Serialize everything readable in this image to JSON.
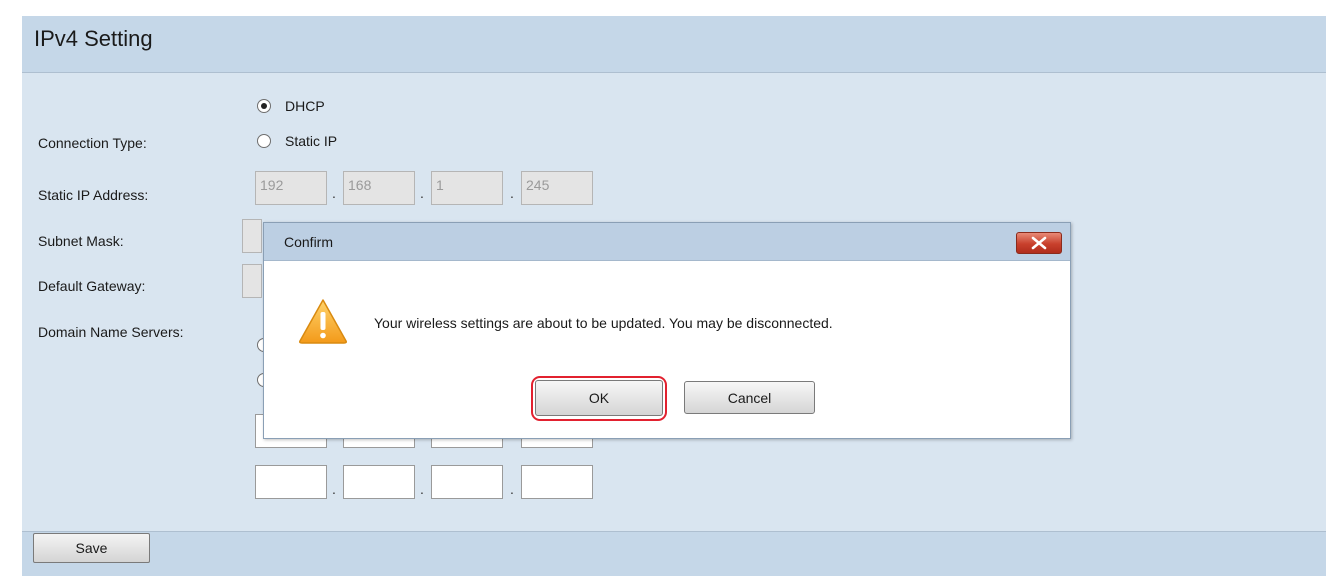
{
  "panel": {
    "title": "IPv4 Setting"
  },
  "form": {
    "connection_type_label": "Connection Type:",
    "connection_options": [
      "DHCP",
      "Static IP"
    ],
    "connection_selected": "DHCP",
    "static_ip_label": "Static IP Address:",
    "static_ip": [
      "192",
      "168",
      "1",
      "245"
    ],
    "subnet_mask_label": "Subnet Mask:",
    "default_gateway_label": "Default Gateway:",
    "dns_label": "Domain Name Servers:",
    "dns_row2": [
      "",
      "",
      "",
      ""
    ]
  },
  "save_button": "Save",
  "dialog": {
    "title": "Confirm",
    "message": "Your wireless settings are about to be updated. You may be disconnected.",
    "ok_label": "OK",
    "cancel_label": "Cancel",
    "icon": "warning-icon",
    "close_icon": "close-icon",
    "highlight_color": "#e2212f"
  }
}
